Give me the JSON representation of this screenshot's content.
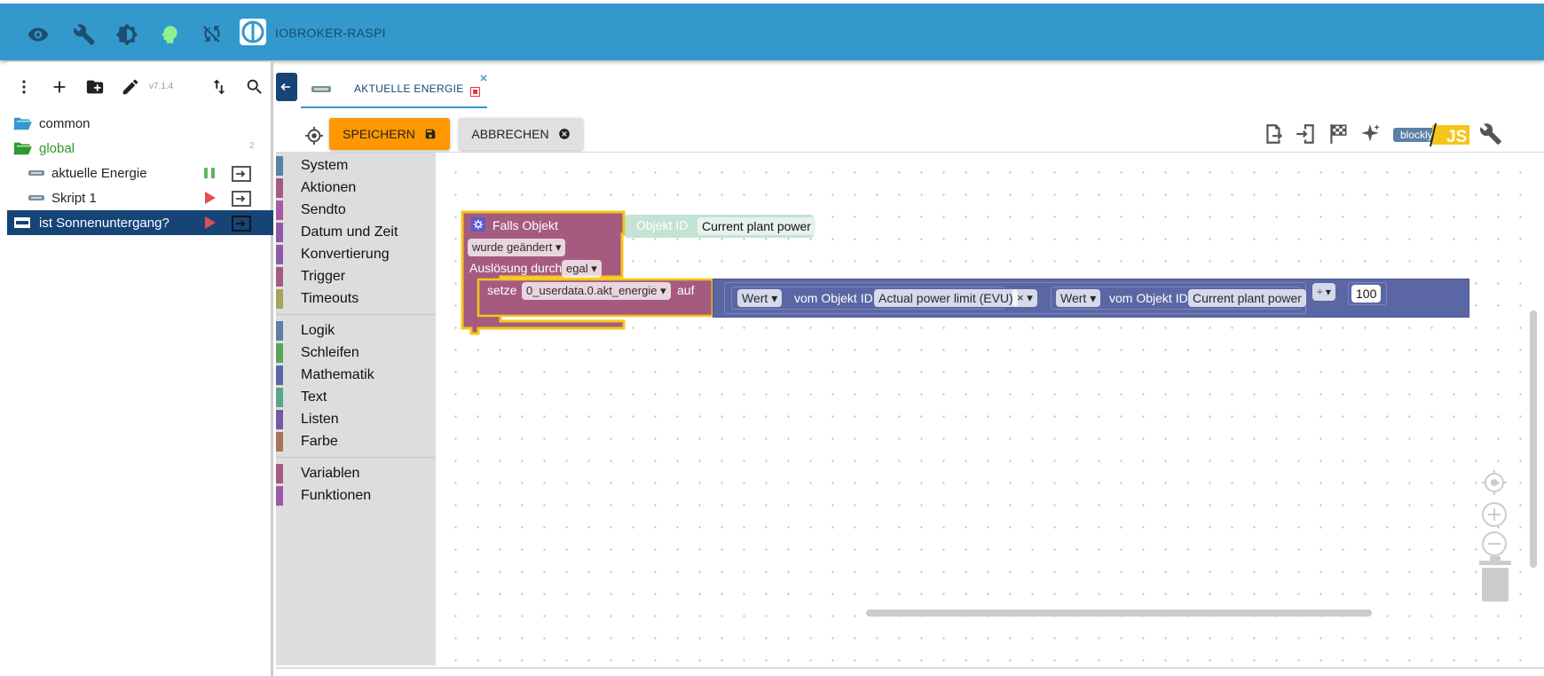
{
  "header": {
    "app_name": "IOBROKER-RASPI",
    "icons": [
      "eye-icon",
      "wrench-icon",
      "brightness-icon",
      "head-icon",
      "sync-off-icon"
    ]
  },
  "left_panel": {
    "version": "v7.1.4",
    "tree": [
      {
        "label": "common",
        "type": "folder-open",
        "badge": ""
      },
      {
        "label": "global",
        "type": "folder-open",
        "badge": "2",
        "color": "#2e9a2e"
      },
      {
        "label": "aktuelle Energie",
        "type": "script",
        "state": "paused"
      },
      {
        "label": "Skript 1",
        "type": "script",
        "state": "stopped"
      },
      {
        "label": "ist Sonnenuntergang?",
        "type": "rules",
        "state": "stopped",
        "selected": true
      }
    ]
  },
  "tab": {
    "label": "AKTUELLE ENERGIE"
  },
  "toolbar": {
    "save_label": "SPEICHERN",
    "cancel_label": "ABBRECHEN",
    "mode_blockly": "blockly",
    "mode_js": "JS"
  },
  "toolbox": {
    "group1": [
      {
        "label": "System",
        "color": "#5b80a5"
      },
      {
        "label": "Aktionen",
        "color": "#a55b80"
      },
      {
        "label": "Sendto",
        "color": "#a55ba5"
      },
      {
        "label": "Datum und Zeit",
        "color": "#8e5ba5"
      },
      {
        "label": "Konvertierung",
        "color": "#8e5ba5"
      },
      {
        "label": "Trigger",
        "color": "#a55b80"
      },
      {
        "label": "Timeouts",
        "color": "#a5a55b"
      }
    ],
    "group2": [
      {
        "label": "Logik",
        "color": "#5b80a5"
      },
      {
        "label": "Schleifen",
        "color": "#5ba55b"
      },
      {
        "label": "Mathematik",
        "color": "#5b67a5"
      },
      {
        "label": "Text",
        "color": "#5ba58c"
      },
      {
        "label": "Listen",
        "color": "#745ba5"
      },
      {
        "label": "Farbe",
        "color": "#a5745b"
      }
    ],
    "group3": [
      {
        "label": "Variablen",
        "color": "#a55b80"
      },
      {
        "label": "Funktionen",
        "color": "#995ba5"
      }
    ]
  },
  "blocks": {
    "trigger_title": "Falls Objekt",
    "objekt_id_label": "Objekt ID",
    "trigger_object": "Current plant power",
    "changed": "wurde geändert",
    "ausloesung_label": "Auslösung durch",
    "ausloesung_value": "egal",
    "setze": "setze",
    "variable": "0_userdata.0.akt_energie",
    "auf": "auf",
    "wert1": "Wert",
    "vom1": "vom Objekt ID",
    "obj1": "Actual power limit (EVU)",
    "op_mul": "×",
    "wert2": "Wert",
    "vom2": "vom Objekt ID",
    "obj2": "Current plant power",
    "op_div": "÷",
    "num": "100"
  },
  "colors": {
    "topbar": "#3399cc",
    "selected": "#164477",
    "save": "#ff9800",
    "trigger_block": "#a55b80",
    "math_block": "#5b67a5"
  }
}
